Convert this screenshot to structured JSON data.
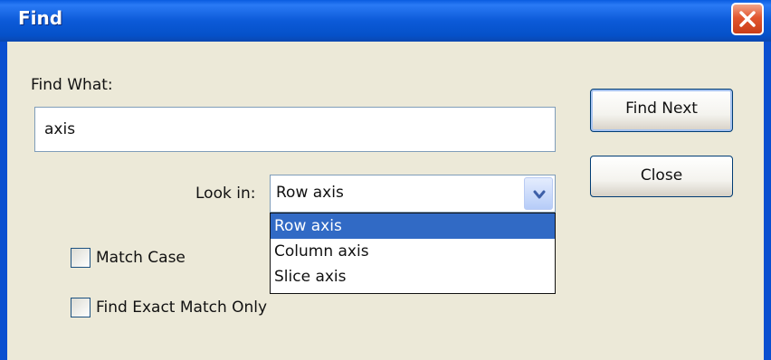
{
  "window": {
    "title": "Find",
    "close_icon": "close-icon"
  },
  "find_what": {
    "label": "Find What:",
    "value": "axis"
  },
  "buttons": {
    "find_next": "Find Next",
    "close": "Close"
  },
  "look_in": {
    "label": "Look in:",
    "selected": "Row axis",
    "options": [
      "Row axis",
      "Column axis",
      "Slice axis"
    ],
    "highlighted_index": 0
  },
  "options": {
    "match_case": {
      "label": "Match Case",
      "checked": false
    },
    "exact_match": {
      "label": "Find Exact Match Only",
      "checked": false
    }
  },
  "colors": {
    "titlebar": "#0a5ce0",
    "close_button": "#e2562f",
    "dialog_bg": "#ece9d8",
    "selection": "#316ac5"
  }
}
